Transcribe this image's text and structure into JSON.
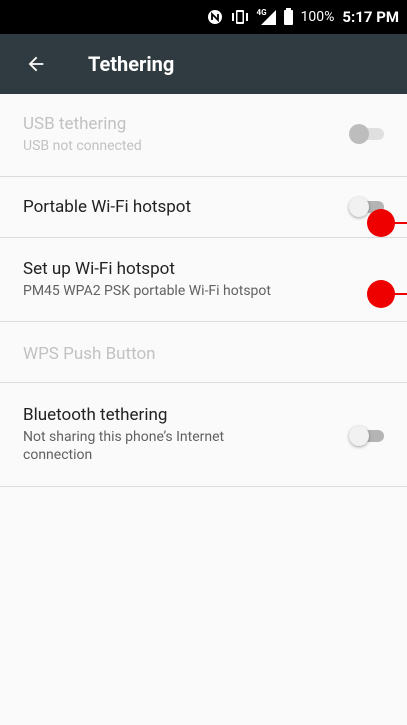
{
  "status_bar": {
    "network": "4G",
    "battery": "100%",
    "time": "5:17 PM"
  },
  "app_bar": {
    "title": "Tethering"
  },
  "items": [
    {
      "title": "USB tethering",
      "subtitle": "USB not connected",
      "enabled": false,
      "toggle": false
    },
    {
      "title": "Portable Wi-Fi hotspot",
      "subtitle": "",
      "enabled": true,
      "toggle": false
    },
    {
      "title": "Set up Wi-Fi hotspot",
      "subtitle": "PM45 WPA2 PSK portable Wi-Fi hotspot",
      "enabled": true
    },
    {
      "title": "WPS Push Button",
      "subtitle": "",
      "enabled": false
    },
    {
      "title": "Bluetooth tethering",
      "subtitle": "Not sharing this phone’s Internet connection",
      "enabled": true,
      "toggle": false
    }
  ],
  "colors": {
    "app_bar": "#2f3b40",
    "status_bar": "#000000",
    "background": "#fafafa",
    "marker": "#ee0000"
  },
  "icons": [
    "nfc-icon",
    "vibrate-icon",
    "signal-4g-icon",
    "battery-icon",
    "back-arrow-icon"
  ]
}
